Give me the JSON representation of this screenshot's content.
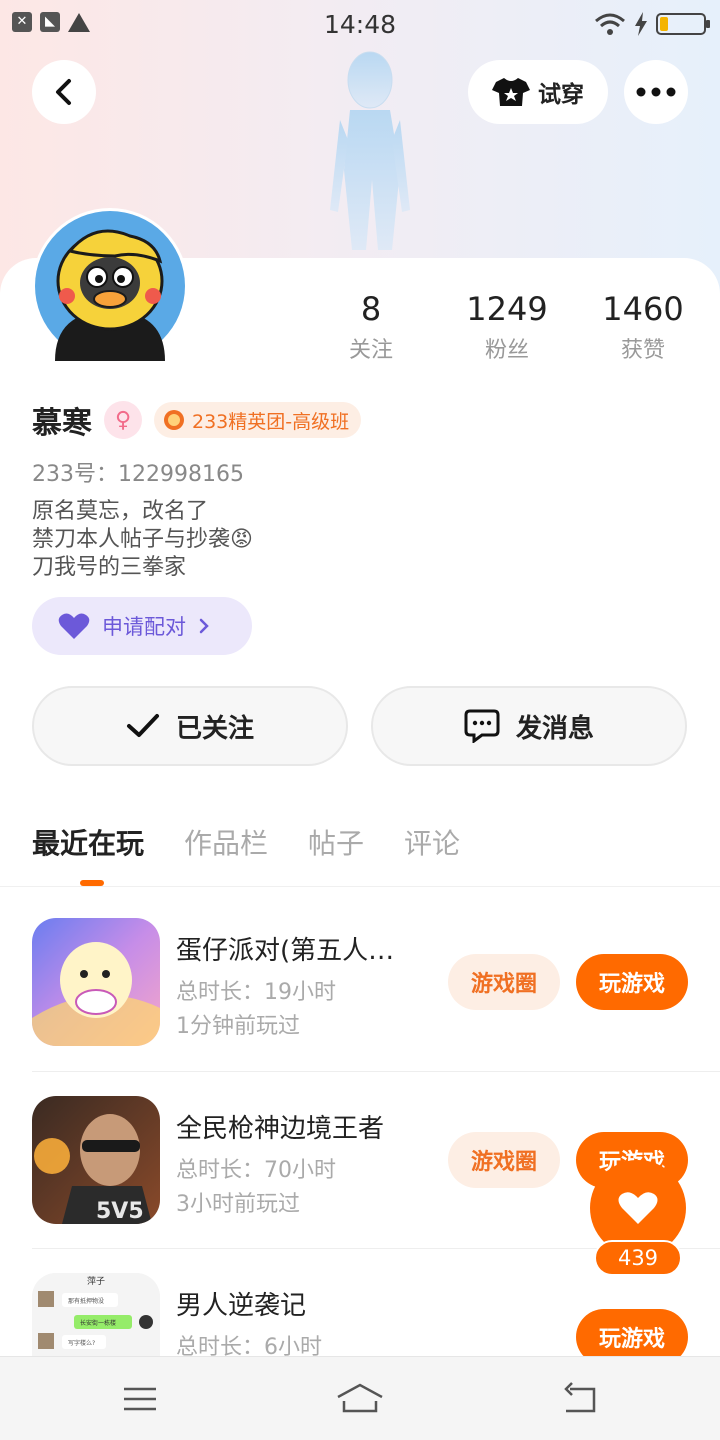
{
  "status_bar": {
    "time": "14:48",
    "battery_level": 0.2
  },
  "header": {
    "try_on_label": "试穿"
  },
  "profile": {
    "name": "慕寒",
    "gender": "female",
    "badge": "233精英团-高级班",
    "uid": "233号：122998165",
    "bio_lines": [
      "原名莫忘，改名了",
      "禁刀本人帖子与抄袭😡",
      "刀我号的三拳家"
    ],
    "stats": [
      {
        "value": "8",
        "label": "关注"
      },
      {
        "value": "1249",
        "label": "粉丝"
      },
      {
        "value": "1460",
        "label": "获赞"
      }
    ],
    "pair_label": "申请配对"
  },
  "actions": {
    "followed_label": "已关注",
    "message_label": "发消息"
  },
  "tabs": [
    "最近在玩",
    "作品栏",
    "帖子",
    "评论"
  ],
  "games": [
    {
      "title": "蛋仔派对(第五人…",
      "time": "总时长：19小时",
      "last": "1分钟前玩过",
      "circle_label": "游戏圈",
      "play_label": "玩游戏"
    },
    {
      "title": "全民枪神边境王者",
      "time": "总时长：70小时",
      "last": "3小时前玩过",
      "circle_label": "游戏圈",
      "play_label": "玩游戏"
    },
    {
      "title": "男人逆袭记",
      "time": "总时长：6小时",
      "last": "",
      "circle_label": "",
      "play_label": "玩游戏"
    }
  ],
  "game_icon_text": {
    "game3_header": "萍子",
    "game3_line1": "那有抵押物没",
    "game3_line2": "长安街一栋楼",
    "game3_line3": "写字楼么?"
  },
  "like": {
    "count": "439"
  }
}
